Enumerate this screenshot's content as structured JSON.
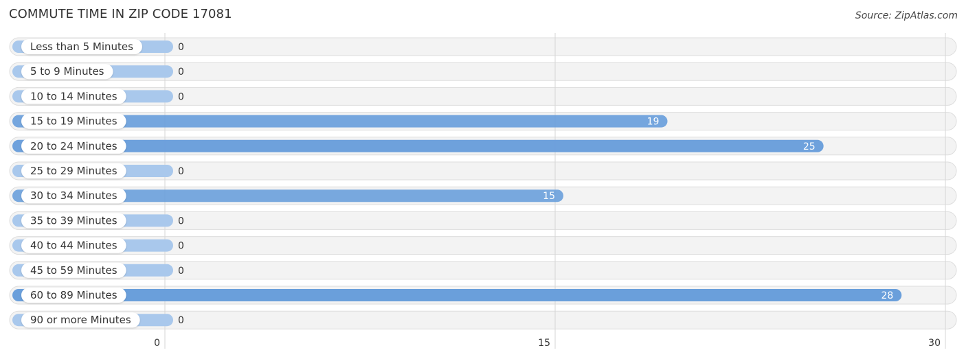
{
  "title": "COMMUTE TIME IN ZIP CODE 17081",
  "source": "Source: ZipAtlas.com",
  "colors": {
    "bar_strong": "#6a9fdb",
    "bar_light": "#a9c8ec",
    "track": "#f3f3f3",
    "track_border": "#dddddd",
    "gridline": "#d6d6d6",
    "label_text": "#333333",
    "value_inside": "#ffffff",
    "value_outside": "#333333"
  },
  "chart_data": {
    "type": "bar",
    "orientation": "horizontal",
    "title": "COMMUTE TIME IN ZIP CODE 17081",
    "xlabel": "",
    "ylabel": "",
    "categories": [
      "Less than 5 Minutes",
      "5 to 9 Minutes",
      "10 to 14 Minutes",
      "15 to 19 Minutes",
      "20 to 24 Minutes",
      "25 to 29 Minutes",
      "30 to 34 Minutes",
      "35 to 39 Minutes",
      "40 to 44 Minutes",
      "45 to 59 Minutes",
      "60 to 89 Minutes",
      "90 or more Minutes"
    ],
    "values": [
      0,
      0,
      0,
      19,
      25,
      0,
      15,
      0,
      0,
      0,
      28,
      0
    ],
    "xlim": [
      0,
      30
    ],
    "xticks": [
      0,
      15,
      30
    ],
    "xtick_labels": [
      "0",
      "15",
      "30"
    ],
    "grid": true,
    "legend": "none"
  }
}
